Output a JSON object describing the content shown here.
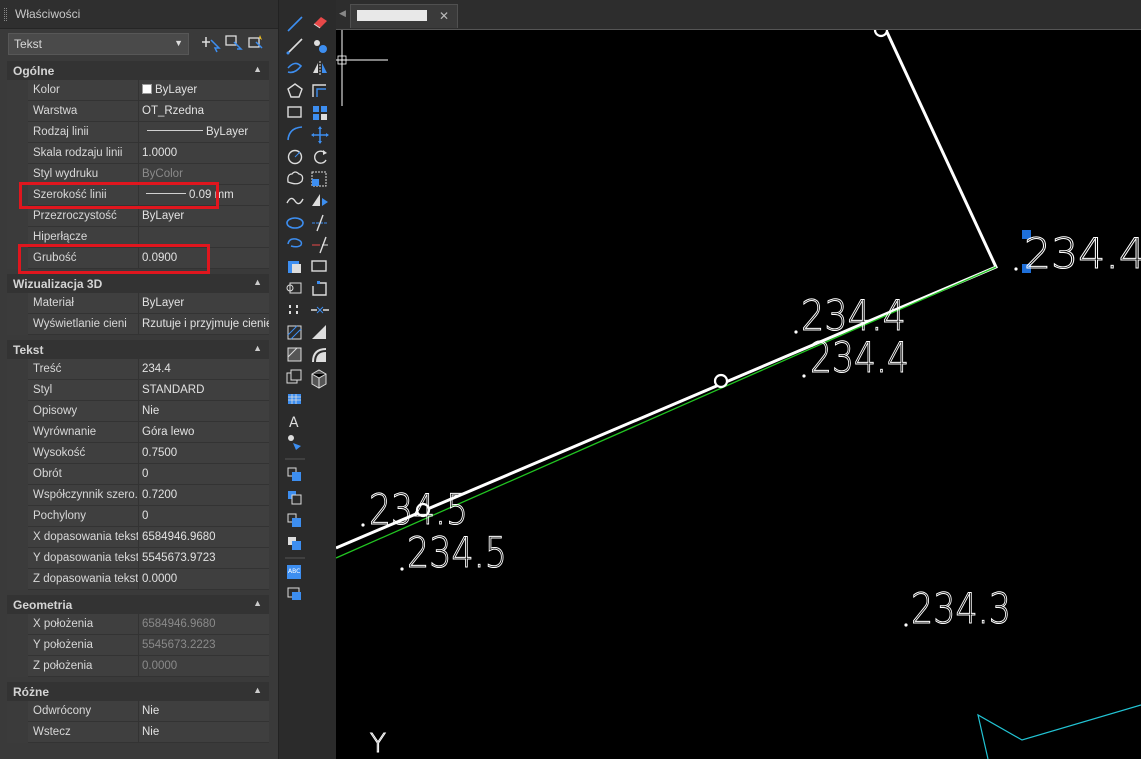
{
  "panel": {
    "title": "Właściwości",
    "selector": {
      "value": "Tekst"
    },
    "sections": {
      "general": {
        "title": "Ogólne",
        "rows": [
          {
            "name": "Kolor",
            "value": "ByLayer"
          },
          {
            "name": "Warstwa",
            "value": "OT_Rzedna"
          },
          {
            "name": "Rodzaj linii",
            "value": "ByLayer"
          },
          {
            "name": "Skala rodzaju linii",
            "value": "1.0000"
          },
          {
            "name": "Styl wydruku",
            "value": "ByColor"
          },
          {
            "name": "Szerokość linii",
            "value": "0.09 mm"
          },
          {
            "name": "Przezroczystość",
            "value": "ByLayer"
          },
          {
            "name": "Hiperłącze",
            "value": ""
          },
          {
            "name": "Grubość",
            "value": "0.0900"
          }
        ]
      },
      "viz3d": {
        "title": "Wizualizacja 3D",
        "rows": [
          {
            "name": "Materiał",
            "value": "ByLayer"
          },
          {
            "name": "Wyświetlanie cieni",
            "value": "Rzutuje i przyjmuje cienie"
          }
        ]
      },
      "text": {
        "title": "Tekst",
        "rows": [
          {
            "name": "Treść",
            "value": "234.4"
          },
          {
            "name": "Styl",
            "value": "STANDARD"
          },
          {
            "name": "Opisowy",
            "value": "Nie"
          },
          {
            "name": "Wyrównanie",
            "value": "Góra lewo"
          },
          {
            "name": "Wysokość",
            "value": "0.7500"
          },
          {
            "name": "Obrót",
            "value": "0"
          },
          {
            "name": "Współczynnik szero...",
            "value": "0.7200"
          },
          {
            "name": "Pochylony",
            "value": "0"
          },
          {
            "name": "X dopasowania tekstu",
            "value": "6584946.9680"
          },
          {
            "name": "Y dopasowania tekstu",
            "value": "5545673.9723"
          },
          {
            "name": "Z dopasowania tekstu",
            "value": "0.0000"
          }
        ]
      },
      "geometry": {
        "title": "Geometria",
        "rows": [
          {
            "name": "X położenia",
            "value": "6584946.9680"
          },
          {
            "name": "Y położenia",
            "value": "5545673.2223"
          },
          {
            "name": "Z położenia",
            "value": "0.0000"
          }
        ]
      },
      "misc": {
        "title": "Różne",
        "rows": [
          {
            "name": "Odwrócony",
            "value": "Nie"
          },
          {
            "name": "Wstecz",
            "value": "Nie"
          }
        ]
      }
    }
  },
  "drawing": {
    "labels": [
      "234.4",
      "234.4",
      "234.4",
      "234.5",
      "234.5",
      "234.3"
    ],
    "axis_label": "Y"
  },
  "colors": {
    "highlight": "#e0161e",
    "grip": "#1e6fd9",
    "green_line": "#22c422",
    "cyan_line": "#22c4d4"
  }
}
